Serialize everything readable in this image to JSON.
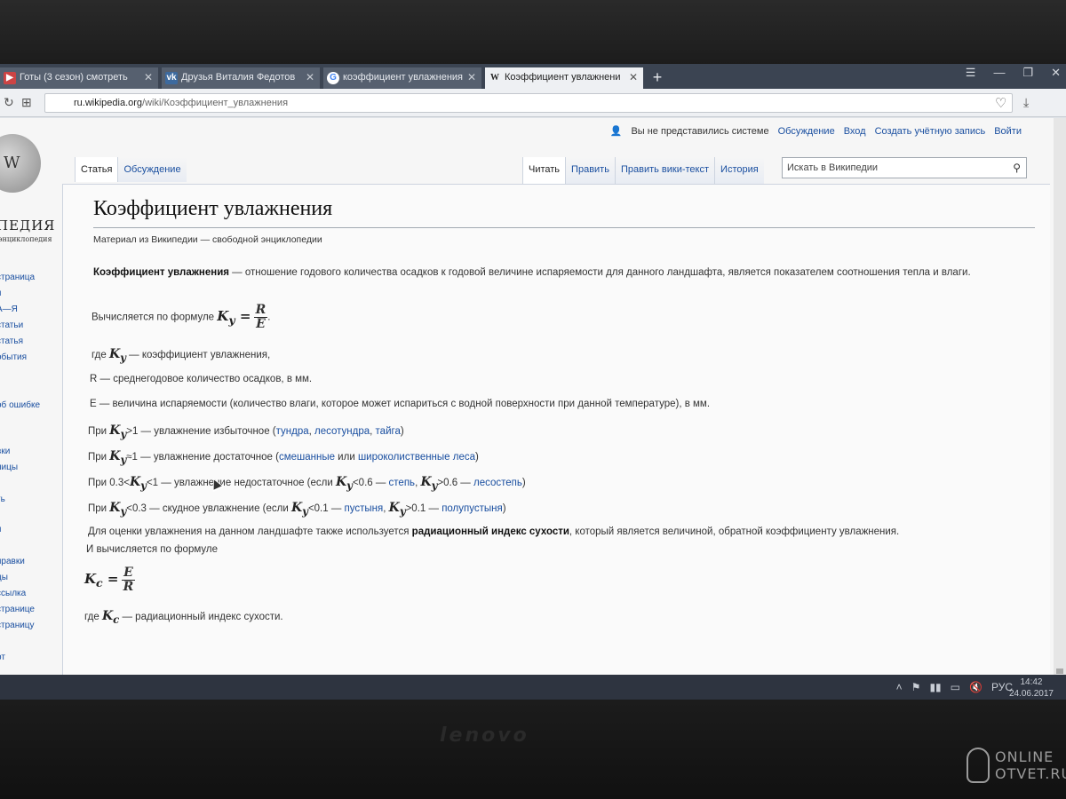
{
  "browser": {
    "tabs": [
      {
        "label": "Готы (3 сезон) смотреть",
        "favicon": "video-icon",
        "active": false
      },
      {
        "label": "Друзья Виталия Федотов",
        "favicon": "vk-icon",
        "active": false
      },
      {
        "label": "коэффициент увлажнения",
        "favicon": "google-icon",
        "active": false
      },
      {
        "label": "Коэффициент увлажнени",
        "favicon": "wikipedia-icon",
        "active": true
      }
    ],
    "url_host": "ru.wikipedia.org",
    "url_path": "/wiki/Коэффициент_увлажнения"
  },
  "wiki": {
    "logo_wordmark": "ПЕДИЯ",
    "logo_tagline": "энциклопедия",
    "sidebar": [
      "страница",
      "я",
      "А—Я",
      "статьи",
      "статья",
      "обытия",
      "об ошибке",
      "вки",
      "ницы",
      "ть",
      "я",
      "правки",
      "цы",
      "ссылка",
      "странице",
      "страницу",
      "рт"
    ],
    "personal": {
      "anon": "Вы не представились системе",
      "talk": "Обсуждение",
      "login": "Вход",
      "create": "Создать учётную запись",
      "logout": "Войти"
    },
    "tabs_left": [
      "Статья",
      "Обсуждение"
    ],
    "tabs_right": [
      "Читать",
      "Править",
      "Править вики-текст",
      "История"
    ],
    "search_placeholder": "Искать в Википедии"
  },
  "article": {
    "title": "Коэффициент увлажнения",
    "site_sub": "Материал из Википедии — свободной энциклопедии",
    "lead_bold": "Коэффициент увлажнения",
    "lead_rest": " — отношение годового количества осадков к годовой величине испаряемости для данного ландшафта, является показателем соотношения тепла и влаги.",
    "formula_intro": "Вычисляется по формуле",
    "ky_sym": "K",
    "ky_sub": "y",
    "kc_sub": "c",
    "formula1_num": "R",
    "formula1_den": "E",
    "where_ky": "— коэффициент увлажнения,",
    "where_prefix": "где",
    "R_def": "R — среднегодовое количество осадков, в мм.",
    "E_def": "E — величина испаряемости (количество влаги, которое может испариться с водной поверхности при данной температуре), в мм.",
    "case1": {
      "pre": "При",
      "cond": ">1 — увлажнение избыточное (",
      "links": [
        "тундра",
        "лесотундра",
        "тайга"
      ],
      "post": ")"
    },
    "case2": {
      "pre": "При",
      "cond": "≈1 — увлажнение достаточное (",
      "link1": "смешанные",
      "mid": " или ",
      "link2": "широколиственные леса",
      "post": ")"
    },
    "case3": {
      "pre": "При 0.3<",
      "cond": "<1 — увлажнение недостаточное (если ",
      "c1": "<0.6 — ",
      "link1": "степь",
      "c2": ">0.6 — ",
      "link2": "лесостепь",
      "post": ")"
    },
    "case4": {
      "pre": "При",
      "cond": "<0.3 — скудное увлажнение (если ",
      "c1": "<0.1 — ",
      "link1": "пустыня",
      "c2": ">0.1 — ",
      "link2": "полупустыня",
      "post": ")"
    },
    "dryness_pre": "Для оценки увлажнения на данном ландшафте также используется ",
    "dryness_bold": "радиационный индекс сухости",
    "dryness_post": ", который является величиной, обратной коэффициенту увлажнения.",
    "dryness_line2": "И вычисляется по формуле",
    "formula2_num": "E",
    "formula2_den": "R",
    "where_kc": "— радиационный индекс сухости."
  },
  "taskbar": {
    "lang": "РУС",
    "time": "14:42",
    "date": "24.06.2017"
  },
  "laptop_brand": "lenovo",
  "watermark": {
    "line1": "ONLINE",
    "line2": "OTVET.RU"
  }
}
